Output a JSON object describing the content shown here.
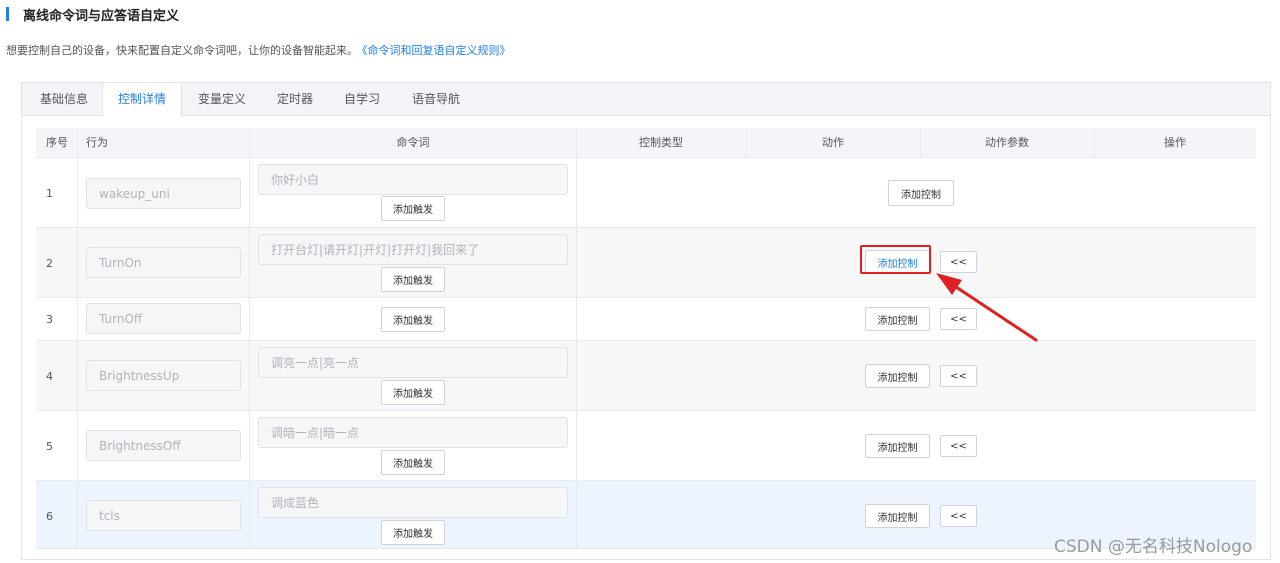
{
  "section": {
    "title": "离线命令词与应答语自定义"
  },
  "description": {
    "text": "想要控制自己的设备，快来配置自定义命令词吧，让你的设备智能起来。",
    "link": "《命令词和回复语自定义规则》"
  },
  "tabs": [
    {
      "label": "基础信息",
      "active": false
    },
    {
      "label": "控制详情",
      "active": true
    },
    {
      "label": "变量定义",
      "active": false
    },
    {
      "label": "定时器",
      "active": false
    },
    {
      "label": "自学习",
      "active": false
    },
    {
      "label": "语音导航",
      "active": false
    }
  ],
  "table": {
    "columns": [
      "序号",
      "行为",
      "命令词",
      "控制类型",
      "动作",
      "动作参数",
      "操作"
    ],
    "add_trigger_label": "添加触发",
    "add_control_label": "添加控制",
    "collapse_label": "<<",
    "rows": [
      {
        "index": "1",
        "action": "wakeup_uni",
        "command": "你好小白",
        "has_collapse": false
      },
      {
        "index": "2",
        "action": "TurnOn",
        "command": "打开台灯|请开灯|开灯|打开灯|我回来了",
        "has_collapse": true,
        "highlighted": true
      },
      {
        "index": "3",
        "action": "TurnOff",
        "command": "",
        "has_collapse": true
      },
      {
        "index": "4",
        "action": "BrightnessUp",
        "command": "调亮一点|亮一点",
        "has_collapse": true
      },
      {
        "index": "5",
        "action": "BrightnessOff",
        "command": "调暗一点|暗一点",
        "has_collapse": true
      },
      {
        "index": "6",
        "action": "tcls",
        "command": "调成蓝色",
        "has_collapse": true,
        "selected": true
      }
    ]
  },
  "watermark": "CSDN @无名科技Nologo",
  "colors": {
    "accent": "#1f7fe8",
    "highlight": "#e02020"
  }
}
